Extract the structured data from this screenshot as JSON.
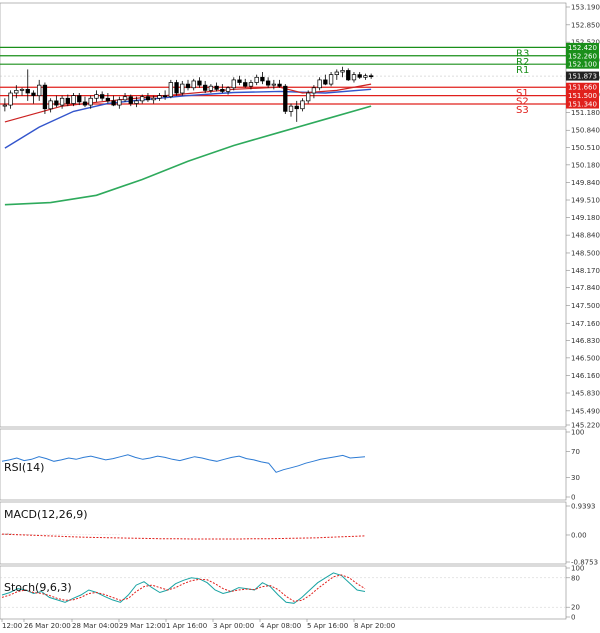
{
  "chart_data": {
    "type": "candlestick",
    "main": {
      "y_ticks": [
        "153.190",
        "152.850",
        "152.520",
        "152.180",
        "151.850",
        "151.520",
        "151.180",
        "150.840",
        "150.510",
        "150.180",
        "149.840",
        "149.510",
        "149.180",
        "148.840",
        "148.500",
        "148.170",
        "147.840",
        "147.500",
        "147.160",
        "146.830",
        "146.500",
        "146.160",
        "145.830",
        "145.490",
        "145.220"
      ],
      "ylim": [
        145.22,
        153.19
      ],
      "current_price": "151.873",
      "current_value": 151.873,
      "resistance": [
        {
          "name": "R1",
          "label": "152.100",
          "value": 152.1
        },
        {
          "name": "R2",
          "label": "152.260",
          "value": 152.26
        },
        {
          "name": "R3",
          "label": "152.420",
          "value": 152.42
        }
      ],
      "support": [
        {
          "name": "S1",
          "label": "151.660",
          "value": 151.66
        },
        {
          "name": "S2",
          "label": "151.500",
          "value": 151.5
        },
        {
          "name": "S3",
          "label": "151.340",
          "value": 151.34
        }
      ],
      "candles": [
        [
          151.3,
          151.45,
          151.2,
          151.32
        ],
        [
          151.32,
          151.6,
          151.25,
          151.55
        ],
        [
          151.55,
          151.7,
          151.45,
          151.6
        ],
        [
          151.6,
          151.65,
          151.5,
          151.62
        ],
        [
          151.62,
          152.0,
          151.4,
          151.55
        ],
        [
          151.55,
          151.6,
          151.35,
          151.5
        ],
        [
          151.5,
          151.8,
          151.4,
          151.7
        ],
        [
          151.7,
          151.75,
          151.15,
          151.25
        ],
        [
          151.25,
          151.45,
          151.18,
          151.4
        ],
        [
          151.4,
          151.5,
          151.28,
          151.32
        ],
        [
          151.32,
          151.5,
          151.25,
          151.45
        ],
        [
          151.45,
          151.52,
          151.3,
          151.35
        ],
        [
          151.35,
          151.55,
          151.3,
          151.5
        ],
        [
          151.5,
          151.55,
          151.32,
          151.38
        ],
        [
          151.38,
          151.48,
          151.28,
          151.32
        ],
        [
          151.32,
          151.5,
          151.25,
          151.45
        ],
        [
          151.45,
          151.6,
          151.38,
          151.52
        ],
        [
          151.52,
          151.58,
          151.4,
          151.45
        ],
        [
          151.45,
          151.55,
          151.35,
          151.4
        ],
        [
          151.4,
          151.5,
          151.3,
          151.32
        ],
        [
          151.32,
          151.48,
          151.25,
          151.42
        ],
        [
          151.42,
          151.55,
          151.38,
          151.48
        ],
        [
          151.48,
          151.52,
          151.3,
          151.35
        ],
        [
          151.35,
          151.48,
          151.28,
          151.4
        ],
        [
          151.4,
          151.52,
          151.35,
          151.48
        ],
        [
          151.48,
          151.55,
          151.38,
          151.42
        ],
        [
          151.42,
          151.5,
          151.35,
          151.45
        ],
        [
          151.45,
          151.55,
          151.4,
          151.5
        ],
        [
          151.5,
          151.6,
          151.42,
          151.48
        ],
        [
          151.48,
          151.8,
          151.45,
          151.75
        ],
        [
          151.75,
          151.8,
          151.5,
          151.55
        ],
        [
          151.55,
          151.78,
          151.5,
          151.72
        ],
        [
          151.72,
          151.8,
          151.6,
          151.65
        ],
        [
          151.65,
          151.82,
          151.6,
          151.78
        ],
        [
          151.78,
          151.85,
          151.65,
          151.7
        ],
        [
          151.7,
          151.78,
          151.55,
          151.6
        ],
        [
          151.6,
          151.72,
          151.55,
          151.68
        ],
        [
          151.68,
          151.75,
          151.58,
          151.62
        ],
        [
          151.62,
          151.72,
          151.55,
          151.58
        ],
        [
          151.58,
          151.68,
          151.52,
          151.65
        ],
        [
          151.65,
          151.85,
          151.6,
          151.8
        ],
        [
          151.8,
          151.88,
          151.7,
          151.75
        ],
        [
          151.75,
          151.82,
          151.65,
          151.68
        ],
        [
          151.68,
          151.8,
          151.62,
          151.75
        ],
        [
          151.75,
          151.9,
          151.7,
          151.85
        ],
        [
          151.85,
          151.95,
          151.72,
          151.78
        ],
        [
          151.78,
          151.85,
          151.65,
          151.7
        ],
        [
          151.7,
          151.8,
          151.62,
          151.72
        ],
        [
          151.72,
          151.8,
          151.65,
          151.68
        ],
        [
          151.68,
          151.72,
          151.15,
          151.2
        ],
        [
          151.2,
          151.35,
          151.1,
          151.3
        ],
        [
          151.3,
          151.4,
          151.0,
          151.25
        ],
        [
          151.25,
          151.45,
          151.2,
          151.4
        ],
        [
          151.4,
          151.6,
          151.35,
          151.55
        ],
        [
          151.55,
          151.7,
          151.45,
          151.65
        ],
        [
          151.65,
          151.85,
          151.6,
          151.8
        ],
        [
          151.8,
          151.9,
          151.7,
          151.72
        ],
        [
          151.72,
          151.95,
          151.68,
          151.9
        ],
        [
          151.9,
          152.0,
          151.8,
          151.95
        ],
        [
          151.95,
          152.05,
          151.85,
          151.98
        ],
        [
          151.98,
          152.02,
          151.78,
          151.8
        ],
        [
          151.8,
          151.95,
          151.75,
          151.9
        ],
        [
          151.9,
          151.95,
          151.82,
          151.85
        ],
        [
          151.85,
          151.92,
          151.8,
          151.88
        ],
        [
          151.88,
          151.92,
          151.82,
          151.87
        ]
      ],
      "ma_fast": [
        [
          0,
          151.0
        ],
        [
          10,
          151.3
        ],
        [
          20,
          151.42
        ],
        [
          30,
          151.52
        ],
        [
          40,
          151.62
        ],
        [
          48,
          151.66
        ],
        [
          52,
          151.55
        ],
        [
          58,
          151.6
        ],
        [
          64,
          151.72
        ]
      ],
      "ma_mid": [
        [
          0,
          150.5
        ],
        [
          6,
          150.9
        ],
        [
          12,
          151.2
        ],
        [
          18,
          151.35
        ],
        [
          24,
          151.42
        ],
        [
          32,
          151.5
        ],
        [
          40,
          151.56
        ],
        [
          48,
          151.58
        ],
        [
          56,
          151.55
        ],
        [
          64,
          151.62
        ]
      ],
      "ma_slow": [
        [
          0,
          149.42
        ],
        [
          8,
          149.46
        ],
        [
          16,
          149.6
        ],
        [
          24,
          149.9
        ],
        [
          32,
          150.25
        ],
        [
          40,
          150.55
        ],
        [
          48,
          150.8
        ],
        [
          56,
          151.05
        ],
        [
          64,
          151.3
        ]
      ]
    },
    "x_ticks": [
      "12:00",
      "26 Mar 20:00",
      "28 Mar 04:00",
      "29 Mar 12:00",
      "1 Apr 16:00",
      "3 Apr 00:00",
      "4 Apr 08:00",
      "5 Apr 16:00",
      "8 Apr 20:00"
    ],
    "rsi": {
      "label": "RSI(14)",
      "y_ticks": [
        "100",
        "70",
        "30",
        "0"
      ],
      "ylim": [
        0,
        100
      ],
      "values": [
        55,
        57,
        60,
        56,
        58,
        62,
        59,
        55,
        57,
        60,
        58,
        61,
        63,
        60,
        57,
        59,
        62,
        65,
        61,
        58,
        60,
        63,
        61,
        58,
        56,
        59,
        62,
        60,
        57,
        55,
        58,
        61,
        63,
        59,
        57,
        54,
        52,
        38,
        42,
        45,
        48,
        52,
        55,
        58,
        60,
        62,
        64,
        60,
        61,
        62
      ]
    },
    "macd": {
      "label": "MACD(12,26,9)",
      "y_ticks": [
        "0.9393",
        "0.00",
        "-0.8753"
      ],
      "ylim": [
        -0.8753,
        0.9393
      ],
      "histogram": [
        0.02,
        0.05,
        0.07,
        0.06,
        0.04,
        0.03,
        0.03,
        0.02,
        0.02,
        0.02,
        0.02,
        0.01,
        0.01,
        0.01,
        0.01,
        0.01,
        0.01,
        0.01,
        0.01,
        0.01,
        0.01,
        0.01,
        0.01,
        0.01,
        0.01,
        0.01,
        0.01,
        0.01,
        0.01,
        0.01,
        0.01,
        0.01,
        0.01,
        0.01,
        0.01,
        0.01,
        0.01,
        0.01,
        0.01,
        0.01
      ],
      "signal": [
        0.03,
        0.01,
        -0.01,
        -0.03,
        -0.05,
        -0.07,
        -0.08,
        -0.09,
        -0.1,
        -0.11,
        -0.12,
        -0.12,
        -0.13,
        -0.13,
        -0.13,
        -0.13,
        -0.12,
        -0.12,
        -0.11,
        -0.1,
        -0.09,
        -0.07,
        -0.05,
        -0.03
      ]
    },
    "stoch": {
      "label": "Stoch(9,6,3)",
      "y_ticks": [
        "100",
        "80",
        "20",
        "0"
      ],
      "ylim": [
        0,
        100
      ],
      "k": [
        45,
        50,
        58,
        55,
        48,
        52,
        40,
        35,
        30,
        38,
        45,
        55,
        50,
        42,
        35,
        30,
        45,
        65,
        72,
        60,
        50,
        55,
        68,
        75,
        80,
        78,
        70,
        55,
        48,
        52,
        60,
        58,
        55,
        70,
        62,
        45,
        30,
        28,
        40,
        55,
        70,
        80,
        90,
        85,
        70,
        55,
        52
      ],
      "d": [
        40,
        45,
        52,
        55,
        50,
        48,
        44,
        38,
        34,
        35,
        40,
        48,
        50,
        46,
        40,
        34,
        38,
        52,
        62,
        65,
        60,
        55,
        60,
        68,
        74,
        77,
        76,
        68,
        58,
        52,
        55,
        57,
        56,
        62,
        64,
        56,
        42,
        32,
        34,
        44,
        58,
        70,
        82,
        86,
        80,
        68,
        58
      ]
    }
  }
}
